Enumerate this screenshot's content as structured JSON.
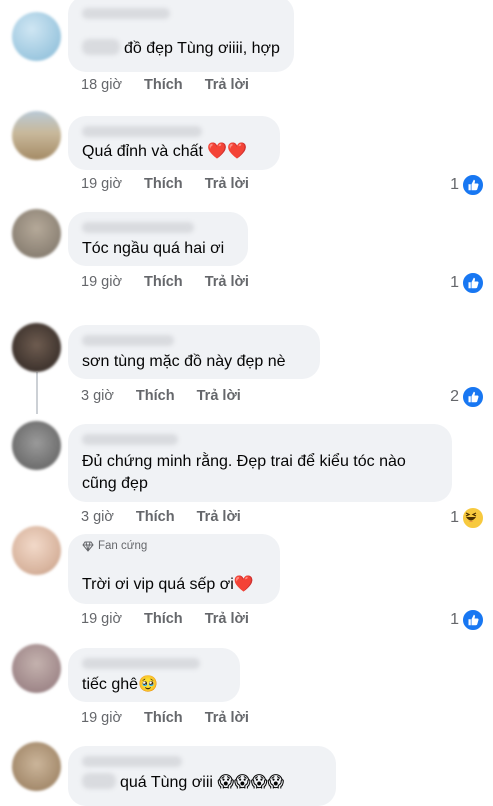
{
  "comments": [
    {
      "text": "đồ đẹp Tùng ơiiii, hợp",
      "time": "18 giờ",
      "like": "Thích",
      "reply": "Trả lời",
      "reactions": null
    },
    {
      "text": "Quá đỉnh và chất ❤️❤️",
      "time": "19 giờ",
      "like": "Thích",
      "reply": "Trả lời",
      "reactions": "1"
    },
    {
      "text": "Tóc ngầu quá hai ơi",
      "time": "19 giờ",
      "like": "Thích",
      "reply": "Trả lời",
      "reactions": "1"
    },
    {
      "text": "sơn tùng mặc đồ này đẹp nè",
      "time": "3 giờ",
      "like": "Thích",
      "reply": "Trả lời",
      "reactions": "2"
    },
    {
      "text_line1": "Đủ chứng minh rằng. Đẹp trai để kiểu tóc nào",
      "text_line2": "cũng đẹp",
      "time": "3 giờ",
      "like": "Thích",
      "reply": "Trả lời",
      "reactions": "1"
    },
    {
      "badge": "Fan cứng",
      "text": "Trời ơi vip quá sếp ơi❤️",
      "time": "19 giờ",
      "like": "Thích",
      "reply": "Trả lời",
      "reactions": "1"
    },
    {
      "text": "tiếc ghê🥹",
      "time": "19 giờ",
      "like": "Thích",
      "reply": "Trả lời",
      "reactions": null
    },
    {
      "text": "quá Tùng ơiii 😱😱😱😱"
    }
  ],
  "colors": {
    "bubble": "#f0f2f5",
    "meta": "#65676b",
    "like_blue": "#1877f2"
  },
  "icons": {
    "like": "like-icon",
    "haha": "haha-icon",
    "badge": "diamond-icon"
  }
}
